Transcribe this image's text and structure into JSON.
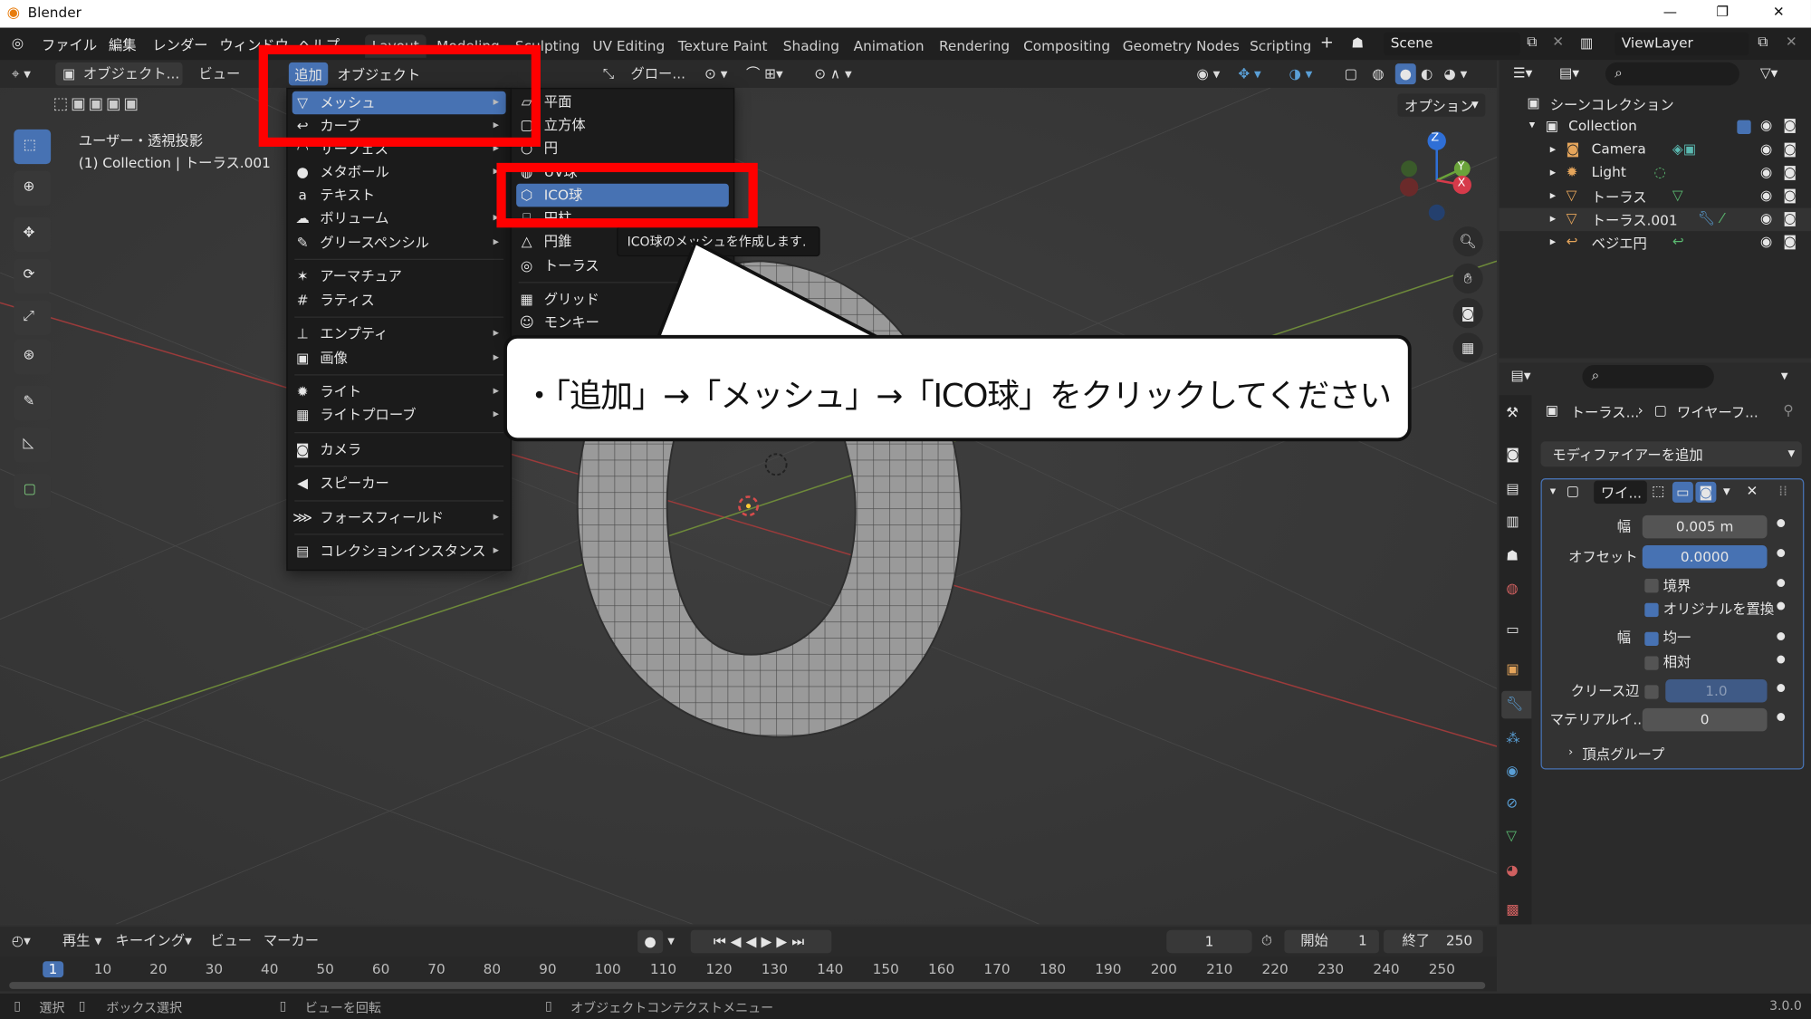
{
  "window": {
    "app_title": "Blender",
    "minimize": "—",
    "maximize": "❐",
    "close": "✕"
  },
  "topmenu": {
    "items": [
      "ファイル",
      "編集",
      "レンダー",
      "ウィンドウ",
      "ヘルプ"
    ],
    "workspaces": [
      "Layout",
      "Modeling",
      "Sculpting",
      "UV Editing",
      "Texture Paint",
      "Shading",
      "Animation",
      "Rendering",
      "Compositing",
      "Geometry Nodes",
      "Scripting"
    ],
    "add_tab": "+",
    "scene": "Scene",
    "view_layer": "ViewLayer"
  },
  "viewport_header": {
    "mode": "オブジェクト...",
    "view": "ビュー",
    "transform": "グロー...",
    "options": "オプション"
  },
  "viewport": {
    "view_name": "ユーザー・透視投影",
    "collection_info": "(1) Collection | トーラス.001",
    "gizmo_axes": [
      "Z",
      "Y",
      "X"
    ]
  },
  "add_menu": {
    "tabs": [
      "追加",
      "オブジェクト"
    ],
    "items": [
      {
        "label": "メッシュ",
        "icon": "▽",
        "submenu": true
      },
      {
        "label": "カーブ",
        "icon": "↩",
        "submenu": true
      },
      {
        "label": "サーフェス",
        "icon": "◠",
        "submenu": true
      },
      {
        "label": "メタボール",
        "icon": "●",
        "submenu": true
      },
      {
        "label": "テキスト",
        "icon": "a",
        "submenu": false
      },
      {
        "label": "ボリューム",
        "icon": "☁",
        "submenu": true
      },
      {
        "label": "グリースペンシル",
        "icon": "✎",
        "submenu": true
      },
      {
        "label": "アーマチュア",
        "icon": "✶",
        "submenu": false
      },
      {
        "label": "ラティス",
        "icon": "#",
        "submenu": false
      },
      {
        "label": "エンプティ",
        "icon": "⊥",
        "submenu": true
      },
      {
        "label": "画像",
        "icon": "▣",
        "submenu": true
      },
      {
        "label": "ライト",
        "icon": "✹",
        "submenu": true
      },
      {
        "label": "ライトプローブ",
        "icon": "▦",
        "submenu": true
      },
      {
        "label": "カメラ",
        "icon": "◙",
        "submenu": false
      },
      {
        "label": "スピーカー",
        "icon": "◀",
        "submenu": false
      },
      {
        "label": "フォースフィールド",
        "icon": "⋙",
        "submenu": true
      },
      {
        "label": "コレクションインスタンス",
        "icon": "▤",
        "submenu": true
      }
    ]
  },
  "mesh_menu": {
    "items": [
      "平面",
      "立方体",
      "円",
      "UV球",
      "ICO球",
      "円柱",
      "円錐",
      "トーラス",
      "グリッド",
      "モンキー"
    ],
    "tooltip": "ICO球のメッシュを作成します."
  },
  "callout": {
    "text": "・「追加」→「メッシュ」→「ICO球」をクリックしてください"
  },
  "outliner": {
    "title": "シーンコレクション",
    "collection": "Collection",
    "items": [
      "Camera",
      "Light",
      "トーラス",
      "トーラス.001",
      "ベジエ円"
    ]
  },
  "properties": {
    "breadcrumb_obj": "トーラス...",
    "breadcrumb_mod": "ワイヤーフ...",
    "add_modifier": "モディファイアーを追加",
    "modifier_name": "ワイ...",
    "rows": {
      "width_label": "幅",
      "width_value": "0.005 m",
      "offset_label": "オフセット",
      "offset_value": "0.0000",
      "boundary": "境界",
      "replace_original": "オリジナルを置換",
      "thickness_label": "幅",
      "even": "均一",
      "relative": "相対",
      "crease_label": "クリース辺",
      "crease_value": "1.0",
      "material_label": "マテリアルイ...",
      "material_value": "0",
      "vertex_group": "頂点グループ"
    }
  },
  "timeline": {
    "playback": "再生",
    "keying": "キーイング",
    "view": "ビュー",
    "marker": "マーカー",
    "current_frame": "1",
    "start_label": "開始",
    "start": "1",
    "end_label": "終了",
    "end": "250",
    "ticks": [
      "1",
      "10",
      "20",
      "30",
      "40",
      "50",
      "60",
      "70",
      "80",
      "90",
      "100",
      "110",
      "120",
      "130",
      "140",
      "150",
      "160",
      "170",
      "180",
      "190",
      "200",
      "210",
      "220",
      "230",
      "240",
      "250"
    ]
  },
  "statusbar": {
    "select": "選択",
    "box_select": "ボックス選択",
    "rotate_view": "ビューを回転",
    "context_menu": "オブジェクトコンテクストメニュー",
    "version": "3.0.0"
  },
  "colors": {
    "accent": "#4772b3",
    "highlight_box": "#ff0000",
    "bg": "#303030"
  }
}
